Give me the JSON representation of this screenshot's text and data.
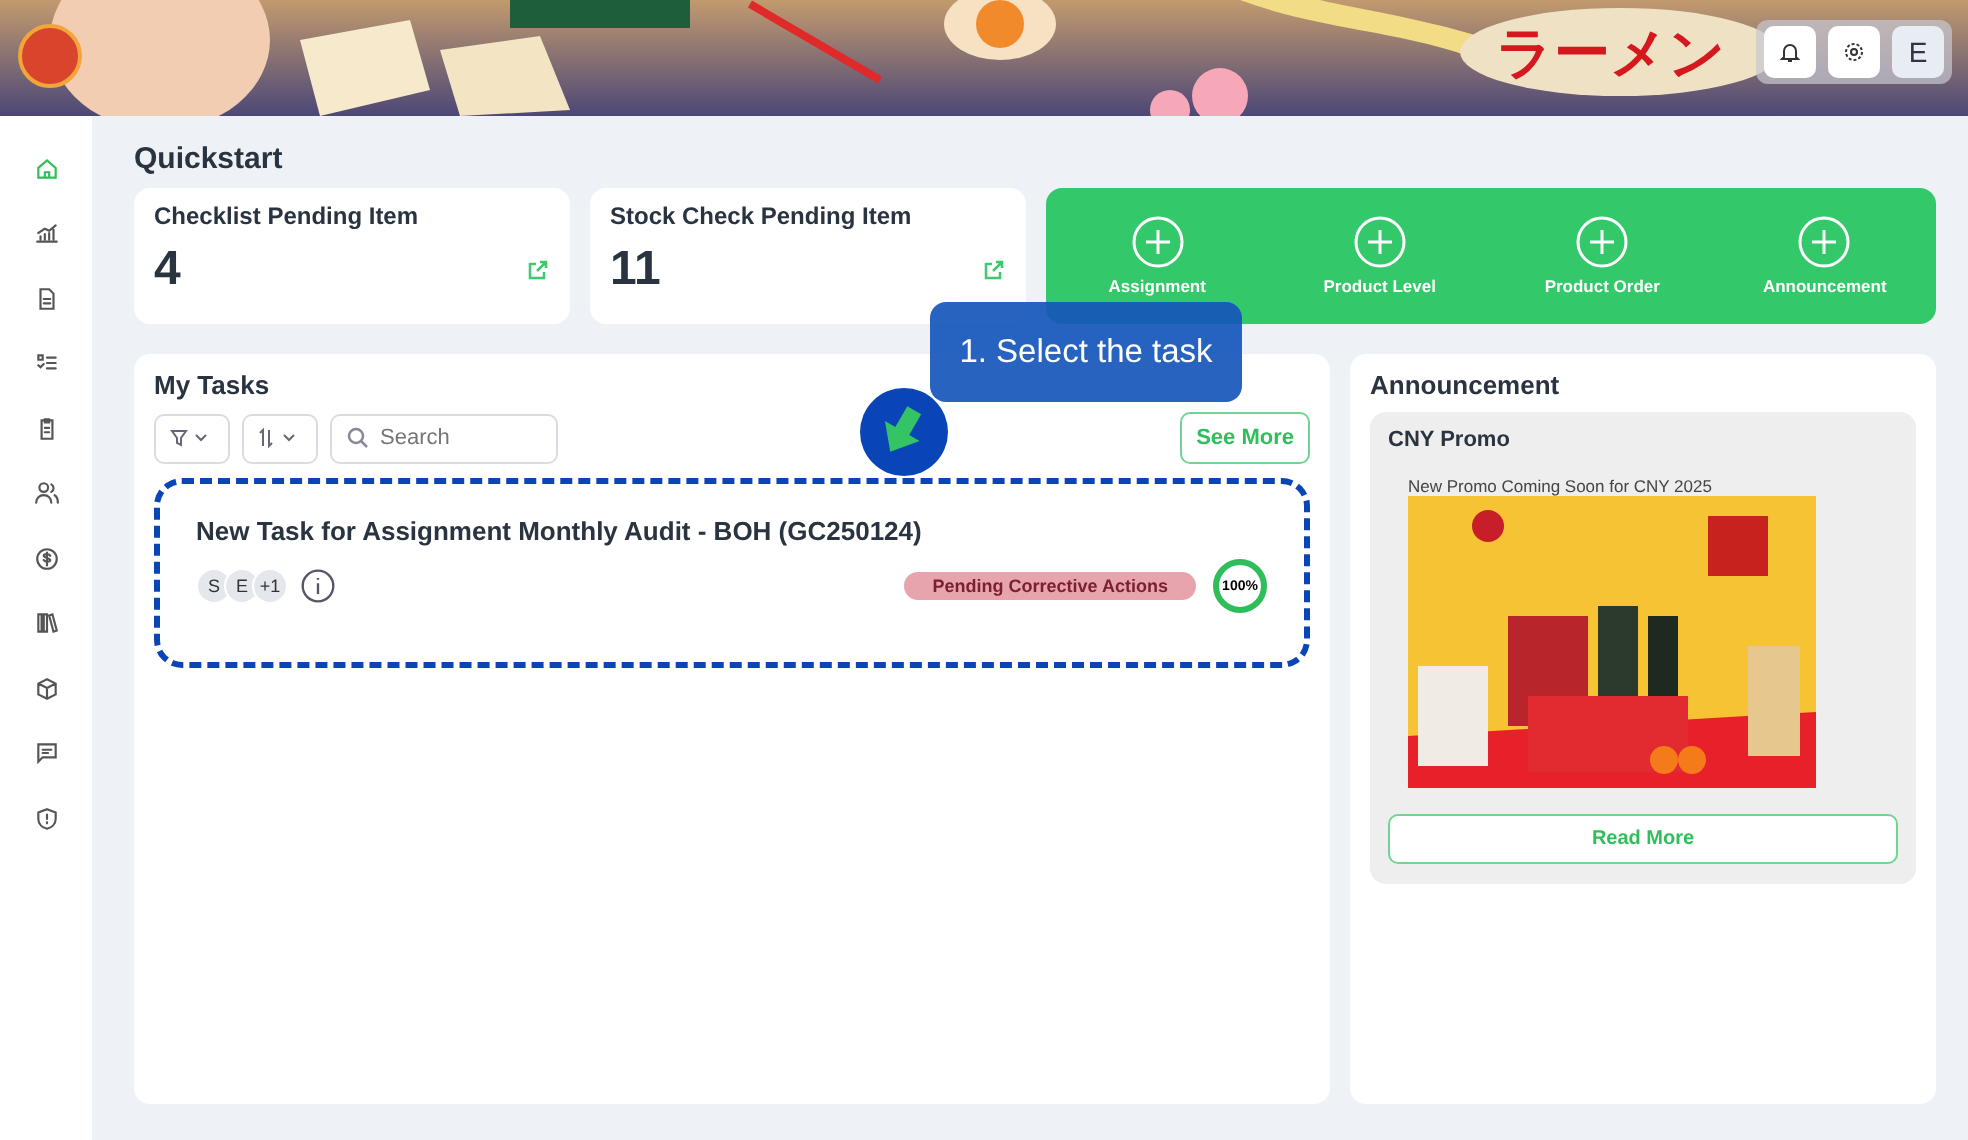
{
  "header": {
    "banner_text": "ラーメン",
    "avatar_initial": "E"
  },
  "sidebar": {
    "items": [
      {
        "selected": true
      },
      {
        "selected": false
      },
      {
        "selected": false
      },
      {
        "selected": false
      },
      {
        "selected": false
      },
      {
        "selected": false
      },
      {
        "selected": false
      },
      {
        "selected": false
      },
      {
        "selected": false
      },
      {
        "selected": false
      },
      {
        "selected": false
      }
    ]
  },
  "quickstart": {
    "title": "Quickstart",
    "stats": [
      {
        "label": "Checklist Pending Item",
        "value": "4"
      },
      {
        "label": "Stock Check Pending Item",
        "value": "11"
      }
    ],
    "actions": [
      "Assignment",
      "Product Level",
      "Product Order",
      "Announcement"
    ]
  },
  "my_tasks": {
    "title": "My Tasks",
    "search": {
      "placeholder": "Search"
    },
    "see_more": "See More",
    "tasks": [
      {
        "title": "New Task for Assignment Monthly Audit - BOH (GC250124)",
        "assignees": [
          "S",
          "E",
          "+1"
        ],
        "status": "Pending Corrective Actions",
        "progress": "100%",
        "level": 1
      }
    ]
  },
  "announcement": {
    "title": "Announcement",
    "items": [
      {
        "title": "CNY Promo",
        "text": "New Promo Coming Soon for CNY 2025",
        "button": "Read More"
      }
    ]
  },
  "tutorial": {
    "tooltip": "1. Select the task"
  }
}
